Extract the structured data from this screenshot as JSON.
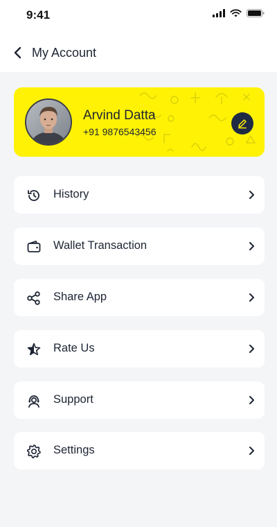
{
  "status_bar": {
    "time": "9:41",
    "icons": [
      "signal-icon",
      "wifi-icon",
      "battery-icon"
    ]
  },
  "header": {
    "title": "My Account",
    "back_icon": "chevron-left-icon"
  },
  "profile": {
    "name": "Arvind Datta",
    "phone": "+91 9876543456",
    "edit_icon": "pencil-icon",
    "card_color": "#fff205"
  },
  "menu": {
    "items": [
      {
        "label": "History",
        "icon": "history-icon"
      },
      {
        "label": "Wallet Transaction",
        "icon": "wallet-icon"
      },
      {
        "label": "Share App",
        "icon": "share-icon"
      },
      {
        "label": "Rate Us",
        "icon": "star-icon"
      },
      {
        "label": "Support",
        "icon": "support-icon"
      },
      {
        "label": "Settings",
        "icon": "gear-icon"
      }
    ],
    "chevron_icon": "chevron-right-icon"
  },
  "colors": {
    "background": "#f4f5f7",
    "accent": "#fff205",
    "text": "#1d2433",
    "edit_button": "#1f2a44"
  }
}
